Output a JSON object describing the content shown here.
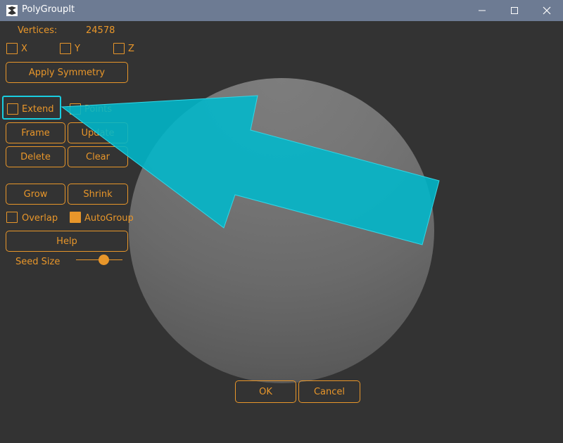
{
  "window": {
    "title": "PolyGroupIt",
    "controls": [
      "minimize-icon",
      "maximize-icon",
      "close-icon"
    ]
  },
  "vertices": {
    "label": "Vertices:",
    "value": "24578"
  },
  "symmetry": {
    "x_label": "X",
    "y_label": "Y",
    "z_label": "Z",
    "x_checked": false,
    "y_checked": false,
    "z_checked": false,
    "apply_label": "Apply Symmetry"
  },
  "options": {
    "extend_label": "Extend",
    "extend_checked": false,
    "points_label": "Points",
    "points_checked": false
  },
  "buttons": {
    "frame": "Frame",
    "update": "Update",
    "delete": "Delete",
    "clear": "Clear",
    "grow": "Grow",
    "shrink": "Shrink",
    "help": "Help",
    "ok": "OK",
    "cancel": "Cancel"
  },
  "grouping": {
    "overlap_label": "Overlap",
    "overlap_checked": false,
    "autogroup_label": "AutoGroup",
    "autogroup_checked": true
  },
  "seed": {
    "label": "Seed Size",
    "value_fraction": 0.6
  },
  "colors": {
    "accent": "#e8962a",
    "background": "#333333",
    "titlebar": "#6d7b93",
    "highlight": "#19cde0"
  }
}
